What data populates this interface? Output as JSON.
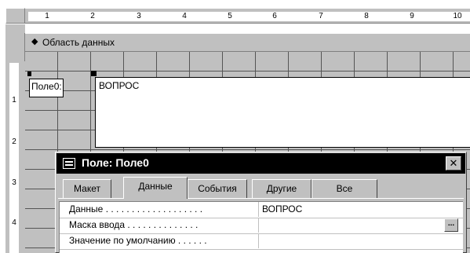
{
  "ruler": {
    "h_ticks": [
      "1",
      "2",
      "3",
      "4",
      "5",
      "6",
      "7",
      "8",
      "9",
      "10"
    ],
    "v_ticks": [
      "1",
      "2",
      "3",
      "4"
    ]
  },
  "section": {
    "marker": "◆",
    "label": "Область данных"
  },
  "form": {
    "field_label": "Поле0:",
    "field_value": "ВОПРОС"
  },
  "property_sheet": {
    "title": "Поле: Поле0",
    "close": "✕",
    "tabs": [
      "Макет",
      "Данные",
      "События",
      "Другие",
      "Все"
    ],
    "active_tab": "Данные",
    "rows": [
      {
        "name": "Данные . . . . . . . . . . . . . . . . . . .",
        "value": "ВОПРОС"
      },
      {
        "name": "Маска ввода . . . . . . . . . . . . . .",
        "value": "",
        "button": "..."
      },
      {
        "name": "Значение по умолчанию . . . . . .",
        "value": ""
      }
    ]
  }
}
